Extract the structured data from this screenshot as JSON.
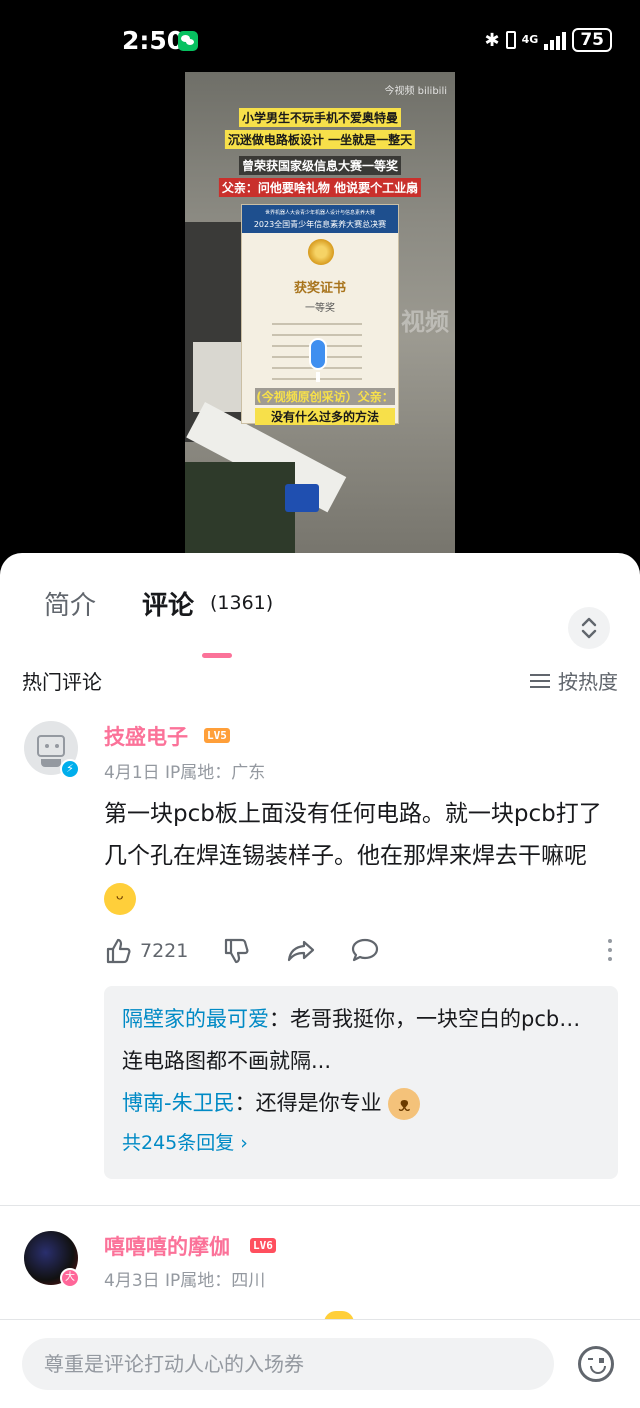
{
  "status_bar": {
    "time": "2:50",
    "network": "4G",
    "battery": "75"
  },
  "video": {
    "watermark": "今视频 bilibili",
    "watermark_overlay": "视频",
    "captions": [
      "小学男生不玩手机不爱奥特曼",
      "沉迷做电路板设计 一坐就是一整天",
      "曾荣获国家级信息大赛一等奖",
      "父亲：问他要啥礼物 他说要个工业扇"
    ],
    "certificate": {
      "header_line1": "世界机器人大会青少年机器人设计与信息素养大赛",
      "header_line2": "2023全国青少年信息素养大赛总决赛",
      "title": "获奖证书",
      "award": "一等奖"
    },
    "bottom_captions": [
      "(今视频原创采访）父亲：",
      "没有什么过多的方法"
    ]
  },
  "tabs": {
    "intro": "简介",
    "comments": "评论",
    "comment_count": "(1361)"
  },
  "section": {
    "title": "热门评论",
    "sort_label": "按热度"
  },
  "comments": [
    {
      "username": "技盛电子",
      "level": "LV5",
      "meta": "4月1日  IP属地：广东",
      "text": "第一块pcb板上面没有任何电路。就一块pcb打了几个孔在焊连锡装样子。他在那焊来焊去干嘛呢",
      "likes": "7221",
      "replies": [
        {
          "user": "隔壁家的最可爱",
          "text": "：老哥我挺你，一块空白的pcb板有锤子用"
        },
        {
          "user": "",
          "text": "连电路图都不画就隔..."
        },
        {
          "user": "博南-朱卫民",
          "text": "：还得是你专业"
        }
      ],
      "more_replies": "共245条回复 ›"
    },
    {
      "username": "嘻嘻嘻的摩伽",
      "level": "LV6",
      "meta": "4月3日  IP属地：四川"
    }
  ],
  "input": {
    "placeholder": "尊重是评论打动人心的入场券"
  },
  "colors": {
    "accent_pink": "#fb7299",
    "link_blue": "#008ac5",
    "lv5": "#ff9f39",
    "lv6": "#ff4f5e"
  }
}
